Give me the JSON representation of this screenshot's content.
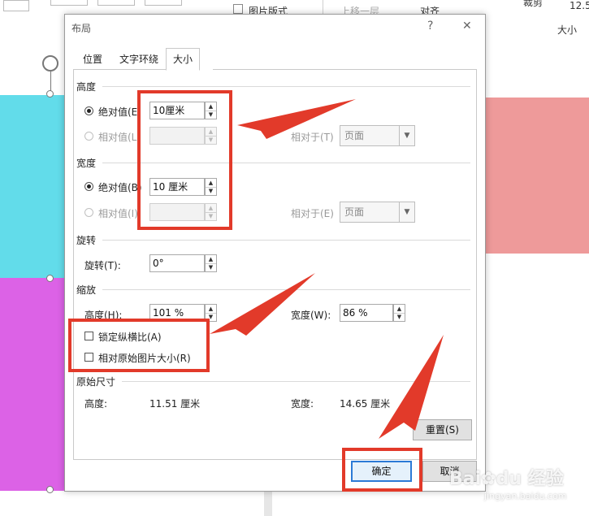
{
  "ribbon": {
    "picture_layout": "图片版式",
    "bring_forward": "上移一层",
    "align": "对齐",
    "crop": "裁剪",
    "width_value": "12.5",
    "size_group": "大小"
  },
  "dialog": {
    "title": "布局",
    "help": "?",
    "close": "✕",
    "tabs": [
      "位置",
      "文字环绕",
      "大小"
    ],
    "active_tab": "大小",
    "height_section": {
      "title": "高度",
      "absolute_label": "绝对值(E)",
      "absolute_value": "10厘米",
      "relative_label": "相对值(L)",
      "relative_value": "",
      "relative_to_label": "相对于(T)",
      "relative_to_value": "页面"
    },
    "width_section": {
      "title": "宽度",
      "absolute_label": "绝对值(B)",
      "absolute_value": "10 厘米",
      "relative_label": "相对值(I)",
      "relative_value": "",
      "relative_to_label": "相对于(E)",
      "relative_to_value": "页面"
    },
    "rotate_section": {
      "title": "旋转",
      "rotate_label": "旋转(T):",
      "rotate_value": "0°"
    },
    "scale_section": {
      "title": "缩放",
      "height_label": "高度(H):",
      "height_value": "101 %",
      "width_label": "宽度(W):",
      "width_value": "86 %",
      "lock_aspect_label": "锁定纵横比(A)",
      "lock_aspect_checked": false,
      "relative_original_label": "相对原始图片大小(R)",
      "relative_original_checked": false
    },
    "original_section": {
      "title": "原始尺寸",
      "height_label": "高度:",
      "height_value": "11.51 厘米",
      "width_label": "宽度:",
      "width_value": "14.65 厘米"
    },
    "reset_button": "重置(S)",
    "ok_button": "确定",
    "cancel_button": "取消"
  },
  "watermark": {
    "brand": "Bai",
    "brand2": "du",
    "suffix": "经验",
    "url": "jingyan.baidu.com"
  },
  "colors": {
    "annotation_red": "#e23a2a",
    "cyan_shape": "#62dcea",
    "magenta_shape": "#dc62e6",
    "pink_shape": "#ee9a9a",
    "ok_border": "#2c7ad6"
  },
  "icons": [
    "rotate-handle-icon",
    "spin-up-icon",
    "spin-down-icon",
    "dropdown-arrow-icon",
    "paw-icon"
  ]
}
